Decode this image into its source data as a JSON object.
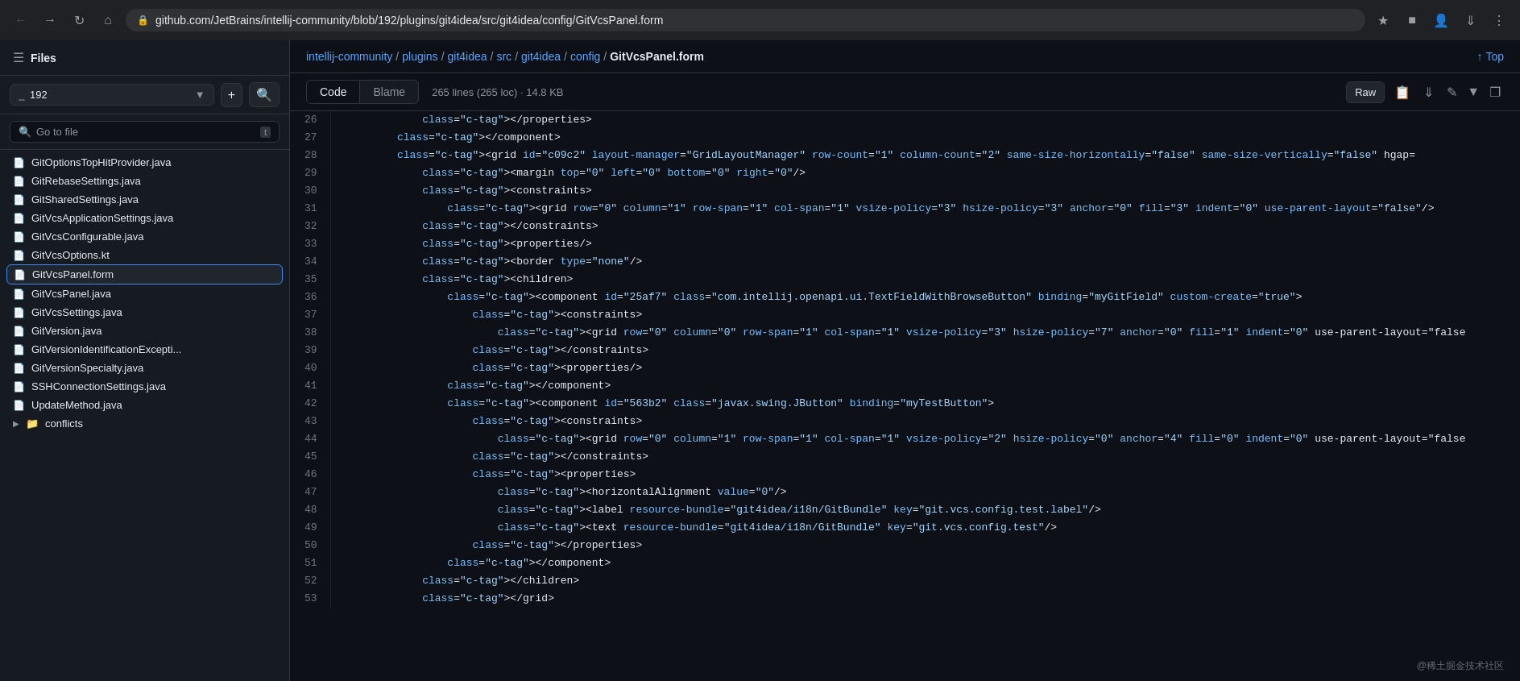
{
  "browser": {
    "url": "github.com/JetBrains/intellij-community/blob/192/plugins/git4idea/src/git4idea/config/GitVcsPanel.form",
    "back_disabled": false,
    "forward_disabled": false
  },
  "sidebar": {
    "title": "Files",
    "branch": "192",
    "search_placeholder": "Go to file",
    "search_shortcut": "t",
    "files": [
      {
        "name": "GitOptionsTopHitProvider.java",
        "type": "file"
      },
      {
        "name": "GitRebaseSettings.java",
        "type": "file"
      },
      {
        "name": "GitSharedSettings.java",
        "type": "file"
      },
      {
        "name": "GitVcsApplicationSettings.java",
        "type": "file"
      },
      {
        "name": "GitVcsConfigurable.java",
        "type": "file"
      },
      {
        "name": "GitVcsOptions.kt",
        "type": "file"
      },
      {
        "name": "GitVcsPanel.form",
        "type": "file",
        "active": true
      },
      {
        "name": "GitVcsPanel.java",
        "type": "file"
      },
      {
        "name": "GitVcsSettings.java",
        "type": "file"
      },
      {
        "name": "GitVersion.java",
        "type": "file"
      },
      {
        "name": "GitVersionIdentificationExcepti...",
        "type": "file"
      },
      {
        "name": "GitVersionSpecialty.java",
        "type": "file"
      },
      {
        "name": "SSHConnectionSettings.java",
        "type": "file"
      },
      {
        "name": "UpdateMethod.java",
        "type": "file"
      }
    ],
    "folder": "conflicts"
  },
  "breadcrumb": {
    "parts": [
      {
        "label": "intellij-community",
        "link": true
      },
      {
        "label": "plugins",
        "link": true
      },
      {
        "label": "git4idea",
        "link": true
      },
      {
        "label": "src",
        "link": true
      },
      {
        "label": "git4idea",
        "link": true
      },
      {
        "label": "config",
        "link": true
      },
      {
        "label": "GitVcsPanel.form",
        "link": false
      }
    ],
    "top_label": "Top"
  },
  "code_toolbar": {
    "tab_code": "Code",
    "tab_blame": "Blame",
    "info": "265 lines (265 loc) · 14.8 KB",
    "raw_label": "Raw"
  },
  "lines": [
    {
      "num": 26,
      "code": "            </properties>"
    },
    {
      "num": 27,
      "code": "        </component>"
    },
    {
      "num": 28,
      "code": "        <grid id=\"c09c2\" layout-manager=\"GridLayoutManager\" row-count=\"1\" column-count=\"2\" same-size-horizontally=\"false\" same-size-vertically=\"false\" hgap="
    },
    {
      "num": 29,
      "code": "            <margin top=\"0\" left=\"0\" bottom=\"0\" right=\"0\"/>"
    },
    {
      "num": 30,
      "code": "            <constraints>"
    },
    {
      "num": 31,
      "code": "                <grid row=\"0\" column=\"1\" row-span=\"1\" col-span=\"1\" vsize-policy=\"3\" hsize-policy=\"3\" anchor=\"0\" fill=\"3\" indent=\"0\" use-parent-layout=\"false\"/>"
    },
    {
      "num": 32,
      "code": "            </constraints>"
    },
    {
      "num": 33,
      "code": "            <properties/>"
    },
    {
      "num": 34,
      "code": "            <border type=\"none\"/>"
    },
    {
      "num": 35,
      "code": "            <children>"
    },
    {
      "num": 36,
      "code": "                <component id=\"25af7\" class=\"com.intellij.openapi.ui.TextFieldWithBrowseButton\" binding=\"myGitField\" custom-create=\"true\">"
    },
    {
      "num": 37,
      "code": "                    <constraints>"
    },
    {
      "num": 38,
      "code": "                        <grid row=\"0\" column=\"0\" row-span=\"1\" col-span=\"1\" vsize-policy=\"3\" hsize-policy=\"7\" anchor=\"0\" fill=\"1\" indent=\"0\" use-parent-layout=\"false"
    },
    {
      "num": 39,
      "code": "                    </constraints>"
    },
    {
      "num": 40,
      "code": "                    <properties/>"
    },
    {
      "num": 41,
      "code": "                </component>"
    },
    {
      "num": 42,
      "code": "                <component id=\"563b2\" class=\"javax.swing.JButton\" binding=\"myTestButton\">"
    },
    {
      "num": 43,
      "code": "                    <constraints>"
    },
    {
      "num": 44,
      "code": "                        <grid row=\"0\" column=\"1\" row-span=\"1\" col-span=\"1\" vsize-policy=\"2\" hsize-policy=\"0\" anchor=\"4\" fill=\"0\" indent=\"0\" use-parent-layout=\"false"
    },
    {
      "num": 45,
      "code": "                    </constraints>"
    },
    {
      "num": 46,
      "code": "                    <properties>"
    },
    {
      "num": 47,
      "code": "                        <horizontalAlignment value=\"0\"/>"
    },
    {
      "num": 48,
      "code": "                        <label resource-bundle=\"git4idea/i18n/GitBundle\" key=\"git.vcs.config.test.label\"/>"
    },
    {
      "num": 49,
      "code": "                        <text resource-bundle=\"git4idea/i18n/GitBundle\" key=\"git.vcs.config.test\"/>"
    },
    {
      "num": 50,
      "code": "                    </properties>"
    },
    {
      "num": 51,
      "code": "                </component>"
    },
    {
      "num": 52,
      "code": "            </children>"
    },
    {
      "num": 53,
      "code": "            </grid>"
    }
  ],
  "watermark": "@稀土掘金技术社区"
}
